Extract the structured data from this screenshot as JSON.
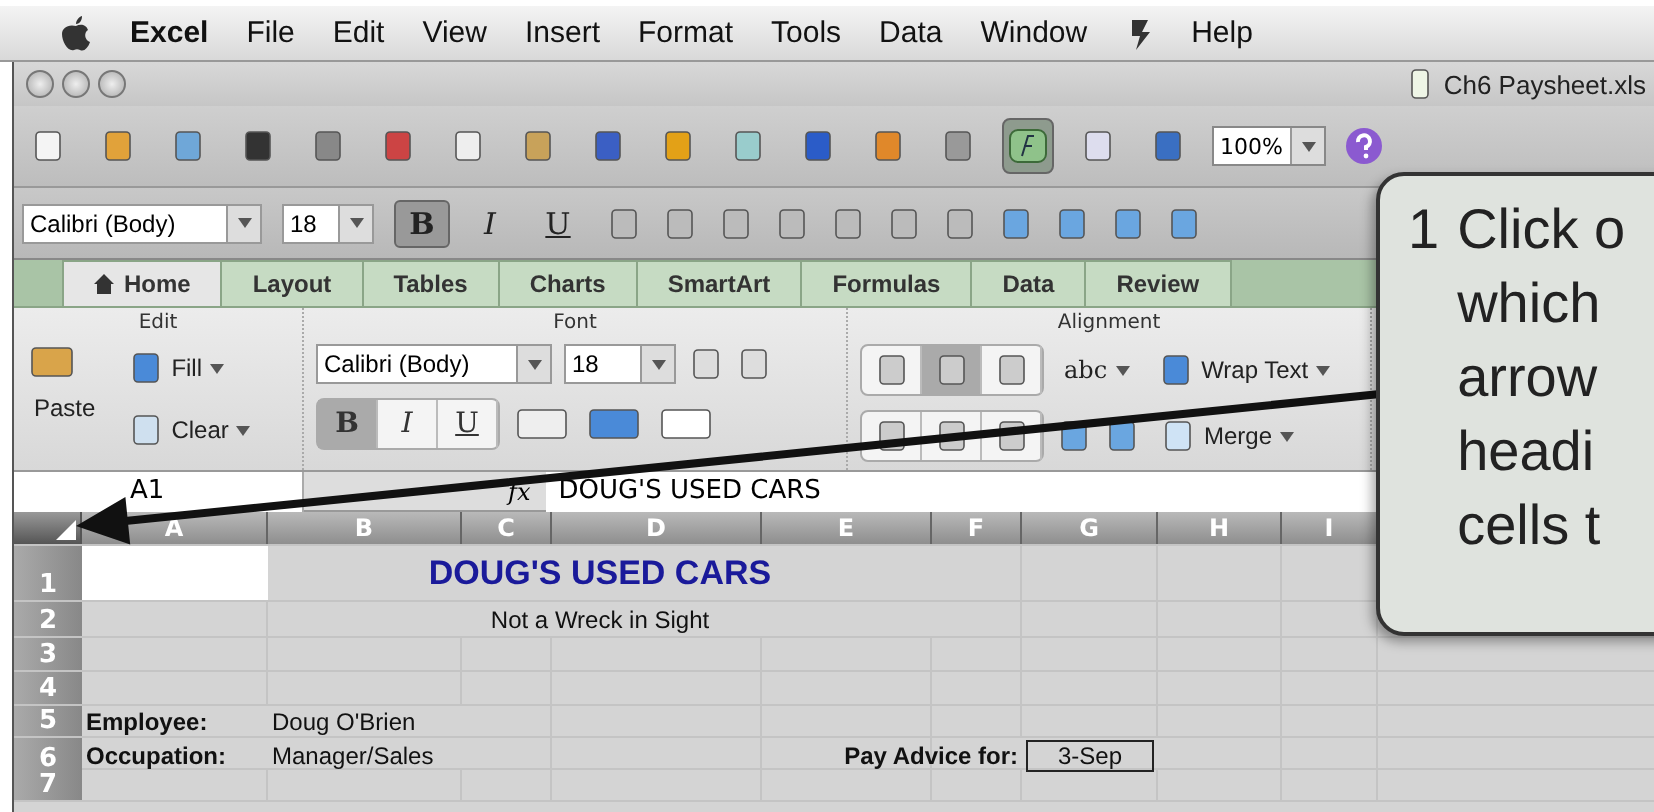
{
  "menu_bar": {
    "app": "Excel",
    "items": [
      "File",
      "Edit",
      "View",
      "Insert",
      "Format",
      "Tools",
      "Data",
      "Window",
      "Help"
    ]
  },
  "window": {
    "title": "Ch6 Paysheet.xls"
  },
  "toolbar": {
    "formula_builder_on": true,
    "zoom": "100%"
  },
  "format_bar": {
    "font": "Calibri (Body)",
    "size": "18",
    "buttons": [
      {
        "label": "B",
        "kind": "bold",
        "on": true
      },
      {
        "label": "I",
        "kind": "italic",
        "on": false
      },
      {
        "label": "U",
        "kind": "underline",
        "on": false
      }
    ]
  },
  "ribbon": {
    "tabs": [
      {
        "label": "Home",
        "selected": true
      },
      {
        "label": "Layout",
        "selected": false
      },
      {
        "label": "Tables",
        "selected": false
      },
      {
        "label": "Charts",
        "selected": false
      },
      {
        "label": "SmartArt",
        "selected": false
      },
      {
        "label": "Formulas",
        "selected": false
      },
      {
        "label": "Data",
        "selected": false
      },
      {
        "label": "Review",
        "selected": false
      }
    ],
    "edit": {
      "title": "Edit",
      "paste": "Paste",
      "fill": "Fill",
      "clear": "Clear"
    },
    "font": {
      "title": "Font",
      "font": "Calibri (Body)",
      "size": "18",
      "buttons": [
        {
          "label": "B",
          "kind": "bold",
          "on": true
        },
        {
          "label": "I",
          "kind": "italic",
          "on": false
        },
        {
          "label": "U",
          "kind": "underline",
          "on": false
        }
      ]
    },
    "alignment": {
      "title": "Alignment",
      "orientation": "abc",
      "wrap": "Wrap Text",
      "merge": "Merge",
      "center_pressed": true
    }
  },
  "formula_bar": {
    "cell": "A1",
    "fx": "fx",
    "value": "DOUG'S USED CARS"
  },
  "sheet": {
    "all_selected": true,
    "columns": [
      "A",
      "B",
      "C",
      "D",
      "E",
      "F",
      "G",
      "H",
      "I"
    ],
    "rows": [
      {
        "number": "1",
        "cells": [
          null,
          {
            "text": "DOUG'S USED CARS",
            "kind": "title"
          }
        ]
      },
      {
        "number": "2",
        "cells": [
          null,
          {
            "text": "Not a Wreck in Sight",
            "kind": "subtitle"
          }
        ]
      },
      {
        "number": "3",
        "cells": []
      },
      {
        "number": "4",
        "cells": []
      },
      {
        "number": "5",
        "cells": [
          {
            "text": "Employee:",
            "kind": "label"
          },
          {
            "text": "Doug O'Brien",
            "kind": "value"
          }
        ]
      },
      {
        "number": "6",
        "cells": [
          {
            "text": "Occupation:",
            "kind": "label"
          },
          {
            "text": "Manager/Sales",
            "kind": "value"
          },
          null,
          null,
          null,
          {
            "text": "Pay Advice for:",
            "kind": "right-label"
          },
          {
            "text": "3-Sep",
            "kind": "boxed"
          }
        ]
      },
      {
        "number": "7",
        "cells": []
      }
    ]
  },
  "callout": {
    "number": "1",
    "lines": [
      "Click o",
      "which",
      "arrow",
      "headi",
      "cells t"
    ]
  }
}
